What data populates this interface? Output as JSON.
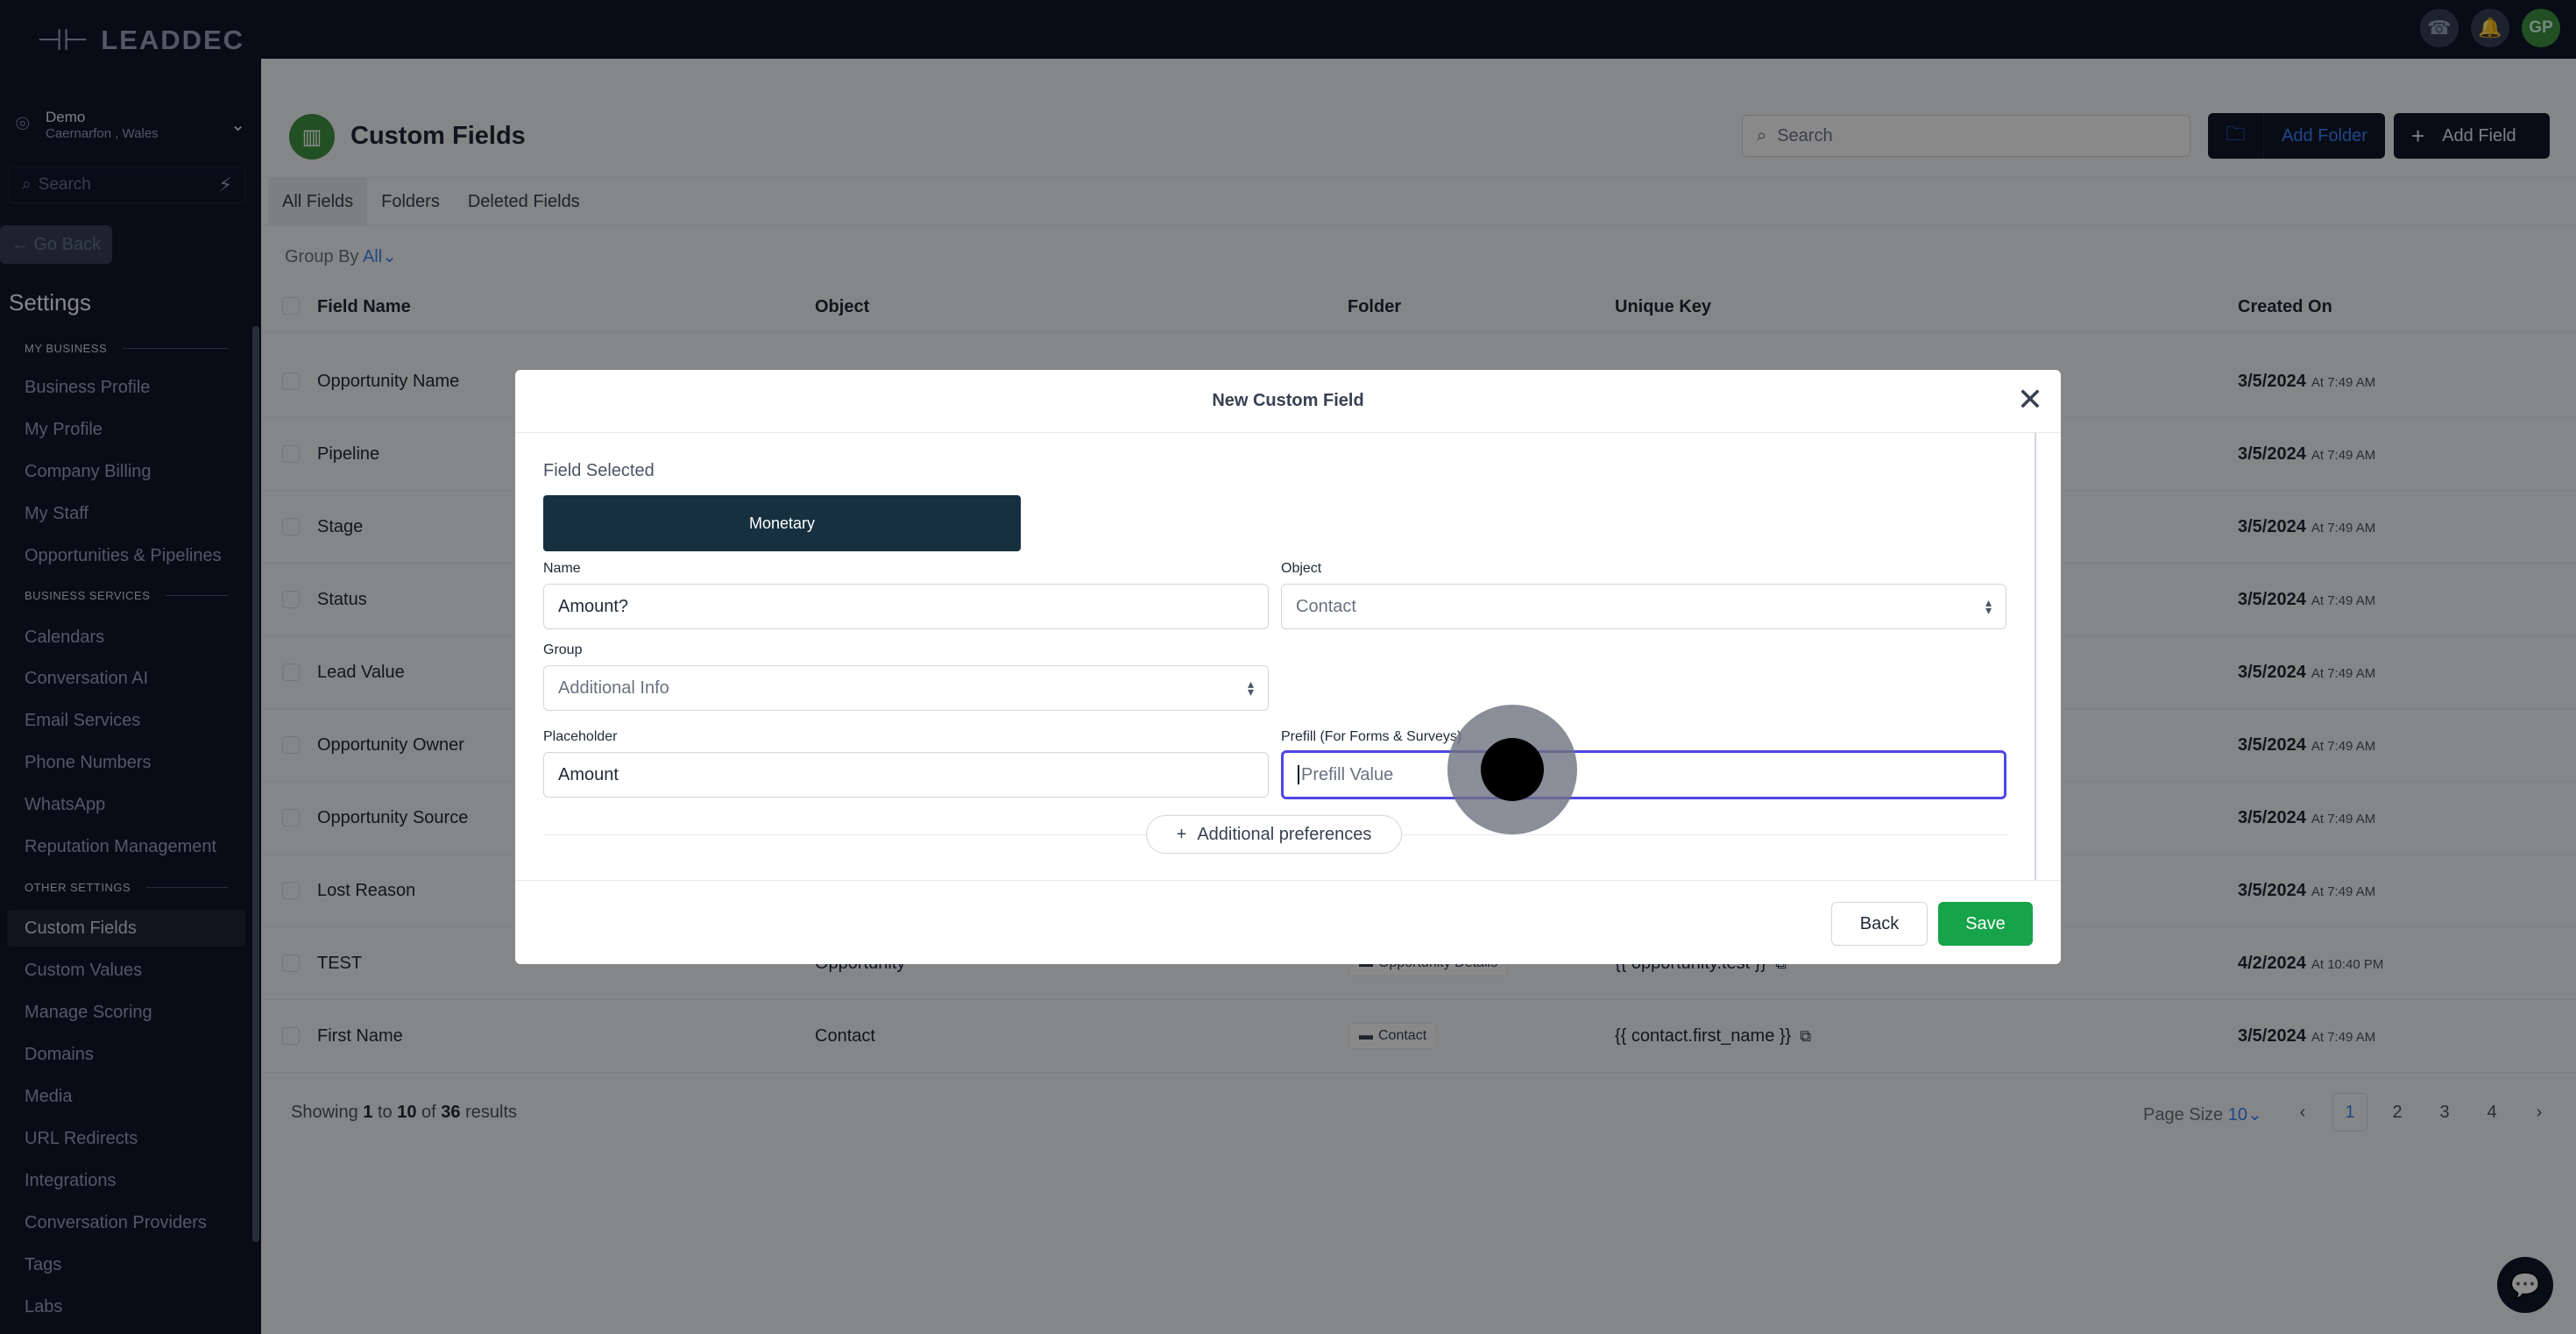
{
  "brand": {
    "name": "LEADDEC"
  },
  "location": {
    "name": "Demo",
    "address": "Caernarfon , Wales"
  },
  "sidebar": {
    "search_placeholder": "Search",
    "go_back": "← Go Back",
    "title": "Settings",
    "sections": {
      "my_business": "MY BUSINESS",
      "business_services": "BUSINESS SERVICES",
      "other_settings": "OTHER SETTINGS"
    },
    "my_business_items": [
      "Business Profile",
      "My Profile",
      "Company Billing",
      "My Staff",
      "Opportunities & Pipelines"
    ],
    "business_services_items": [
      "Calendars",
      "Conversation AI",
      "Email Services",
      "Phone Numbers",
      "WhatsApp",
      "Reputation Management"
    ],
    "other_settings_items": [
      "Custom Fields",
      "Custom Values",
      "Manage Scoring",
      "Domains",
      "Media",
      "URL Redirects",
      "Integrations",
      "Conversation Providers",
      "Tags",
      "Labs"
    ],
    "active_item": "Custom Fields"
  },
  "topbar": {
    "avatar_initials": "GP"
  },
  "page": {
    "title": "Custom Fields",
    "search_placeholder": "Search",
    "add_folder": "Add Folder",
    "add_field": "Add Field",
    "tabs": [
      "All Fields",
      "Folders",
      "Deleted Fields"
    ],
    "group_by_label": "Group By",
    "group_by_value": "All"
  },
  "table": {
    "columns": [
      "Field Name",
      "Object",
      "Folder",
      "Unique Key",
      "Created On"
    ],
    "rows": [
      {
        "name": "Opportunity Name",
        "date": "3/5/2024",
        "time": "At 7:49 AM"
      },
      {
        "name": "Pipeline",
        "date": "3/5/2024",
        "time": "At 7:49 AM"
      },
      {
        "name": "Stage",
        "date": "3/5/2024",
        "time": "At 7:49 AM"
      },
      {
        "name": "Status",
        "date": "3/5/2024",
        "time": "At 7:49 AM"
      },
      {
        "name": "Lead Value",
        "date": "3/5/2024",
        "time": "At 7:49 AM"
      },
      {
        "name": "Opportunity Owner",
        "date": "3/5/2024",
        "time": "At 7:49 AM"
      },
      {
        "name": "Opportunity Source",
        "date": "3/5/2024",
        "time": "At 7:49 AM"
      },
      {
        "name": "Lost Reason",
        "date": "3/5/2024",
        "time": "At 7:49 AM"
      },
      {
        "name": "TEST",
        "object": "Opportunity",
        "folder": "Opportunity Details",
        "key": "{{ opportunity.test }}",
        "date": "4/2/2024",
        "time": "At 10:40 PM"
      },
      {
        "name": "First Name",
        "object": "Contact",
        "folder": "Contact",
        "key": "{{ contact.first_name }}",
        "date": "3/5/2024",
        "time": "At 7:49 AM"
      }
    ]
  },
  "footer": {
    "results_prefix": "Showing",
    "from": "1",
    "to_word": "to",
    "to": "10",
    "of_word": "of",
    "total": "36",
    "results_suffix": "results",
    "page_size_label": "Page Size",
    "page_size_value": "10",
    "pages": [
      "1",
      "2",
      "3",
      "4"
    ],
    "active_page": "1"
  },
  "modal": {
    "title": "New Custom Field",
    "field_selected_label": "Field Selected",
    "field_type": "Monetary",
    "name_label": "Name",
    "name_value": "Amount?",
    "object_label": "Object",
    "object_value": "Contact",
    "group_label": "Group",
    "group_value": "Additional Info",
    "placeholder_label": "Placeholder",
    "placeholder_value": "Amount",
    "prefill_label": "Prefill (For Forms & Surveys)",
    "prefill_placeholder": "Prefill Value",
    "additional_preferences": "Additional preferences",
    "back": "Back",
    "save": "Save"
  }
}
